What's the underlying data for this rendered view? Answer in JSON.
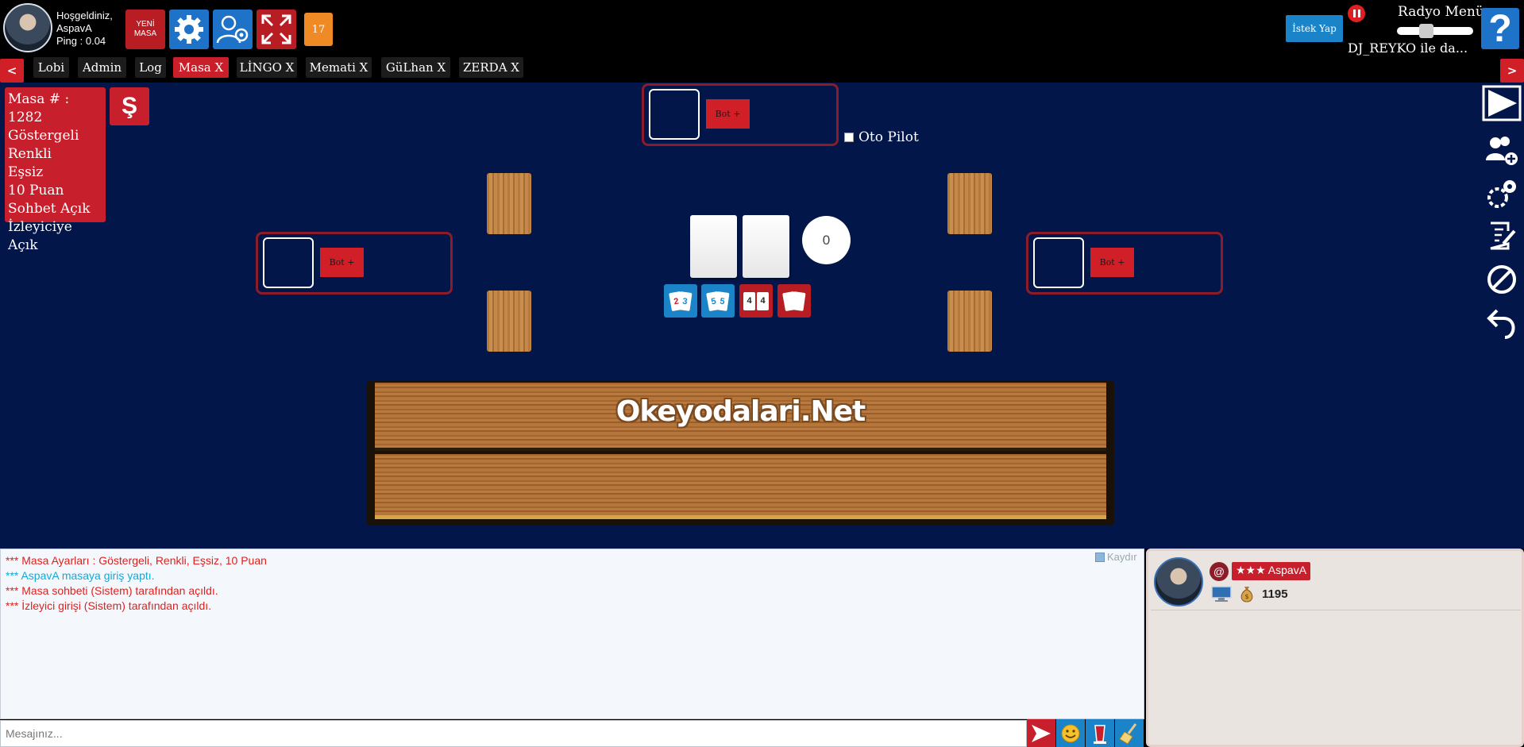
{
  "header": {
    "welcome_line1": "Hoşgeldiniz,",
    "username": "AspavA",
    "ping": "Ping : 0.04",
    "new_table_line1": "YENİ",
    "new_table_line2": "MASA",
    "count_badge": "17"
  },
  "radio": {
    "request_label": "İstek Yap",
    "menu_title": "Radyo Menü",
    "now_playing": "DJ_REYKO ile da...",
    "help_label": "?"
  },
  "tabs": {
    "prev": "<",
    "next": ">",
    "items": [
      {
        "label": "Lobi"
      },
      {
        "label": "Admin"
      },
      {
        "label": "Log"
      },
      {
        "label": "Masa X",
        "active": true
      },
      {
        "label": "LİNGO X"
      },
      {
        "label": "Memati X"
      },
      {
        "label": "GüLhan X"
      },
      {
        "label": "ZERDA X"
      }
    ]
  },
  "table_info": {
    "lines": [
      "Masa # : 1282",
      "Göstergeli",
      "Renkli",
      "Eşsiz",
      "10 Puan",
      "Sohbet Açık",
      "İzleyiciye Açık"
    ],
    "lira_symbol": "Ş"
  },
  "seats": {
    "bot_label": "Bot +"
  },
  "autopilot_label": "Oto Pilot",
  "remaining_tiles": "0",
  "sort_buttons": {
    "color": [
      "2",
      "3"
    ],
    "series": [
      "5",
      "5"
    ],
    "pairs": [
      "4",
      "4"
    ]
  },
  "rack_logo": "Okeyodalari.Net",
  "chat": {
    "lines": [
      {
        "text": "*** Masa Ayarları : Göstergeli, Renkli, Eşsiz, 10 Puan",
        "color": "red"
      },
      {
        "text": "*** AspavA masaya giriş yaptı.",
        "color": "blue"
      },
      {
        "text": "*** Masa sohbeti (Sistem) tarafından açıldı.",
        "color": "red"
      },
      {
        "text": "*** İzleyici girişi (Sistem) tarafından açıldı.",
        "color": "red"
      }
    ],
    "scroll_label": "Kaydır",
    "input_placeholder": "Mesajınız..."
  },
  "player": {
    "at": "@",
    "stars": "★★★",
    "name": "AspavA",
    "chips": "1195"
  },
  "colors": {
    "table_bg": "#02164a",
    "accent_red": "#c81f2c",
    "accent_blue": "#1b84c8",
    "badge_orange": "#f08a24"
  }
}
